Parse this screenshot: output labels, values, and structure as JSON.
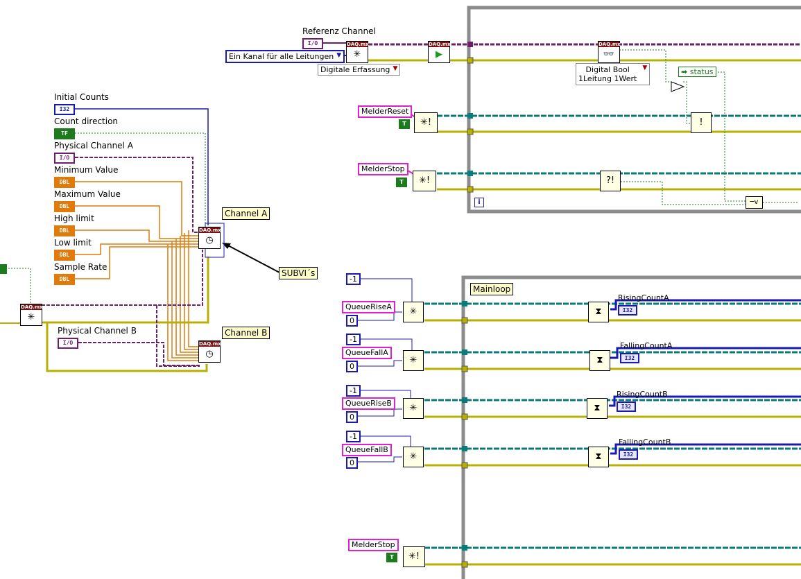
{
  "left": {
    "inputs": [
      {
        "label": "Initial Counts",
        "type": "I32"
      },
      {
        "label": "Count direction",
        "type": "TF"
      },
      {
        "label": "Physical Channel A",
        "type": "I/O"
      },
      {
        "label": "Minimum Value",
        "type": "DBL"
      },
      {
        "label": "Maximum Value",
        "type": "DBL"
      },
      {
        "label": "High limit",
        "type": "DBL"
      },
      {
        "label": "Low limit",
        "type": "DBL"
      },
      {
        "label": "Sample Rate",
        "type": "DBL"
      }
    ],
    "physical_channel_b": {
      "label": "Physical Channel B",
      "type": "I/O"
    },
    "channel_a_tag": "Channel A",
    "channel_b_tag": "Channel B",
    "subvis_tag": "SUBVI´s",
    "daqmx_header": "DAQ.mx"
  },
  "top": {
    "referenz_label": "Referenz Channel",
    "referenz_type": "I/O",
    "line_grouping": "Ein Kanal für alle Leitungen",
    "measurement": "Digitale Erfassung",
    "read_mode_line1": "Digital Bool",
    "read_mode_line2": "1Leitung 1Wert",
    "melder_reset": "MelderReset",
    "melder_stop": "MelderStop",
    "bool_const": "T",
    "status_label": "status",
    "loop_index": "i"
  },
  "mainloop": {
    "title": "Mainloop",
    "rows": [
      {
        "queue": "QueueRiseA",
        "const_top": "-1",
        "const_bottom": "0",
        "output": "RisingCountA",
        "ind": "I32"
      },
      {
        "queue": "QueueFallA",
        "const_top": "-1",
        "const_bottom": "0",
        "output": "FallingCountA",
        "ind": "I32"
      },
      {
        "queue": "QueueRiseB",
        "const_top": "-1",
        "const_bottom": "0",
        "output": "RisingCountB",
        "ind": "I32"
      },
      {
        "queue": "QueueFallB",
        "const_top": "-1",
        "const_bottom": "0",
        "output": "FallingCountB",
        "ind": "I32"
      }
    ],
    "melder_stop": "MelderStop"
  },
  "colors": {
    "error_wire": "#b8b000",
    "refnum_wire": "#0a7a7a",
    "dbl_wire": "#e07a0a",
    "io_wire": "#6b1f6b",
    "int_wire": "#1a1ab0",
    "bool_wire": "#1d7a1d"
  }
}
